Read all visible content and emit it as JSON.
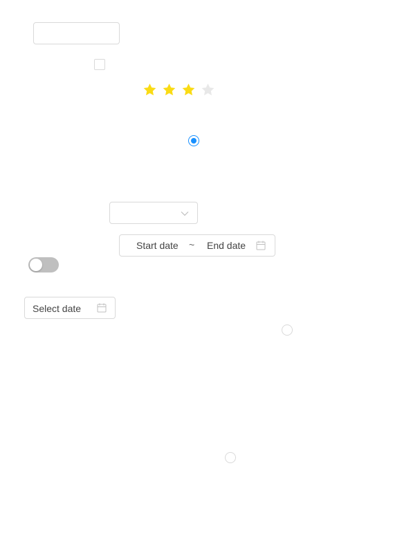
{
  "form": {
    "text_input": {
      "value": "",
      "placeholder": ""
    },
    "checkbox": {
      "checked": false
    },
    "rating": {
      "value": 3,
      "max": 5,
      "filled_color": "#fadb14",
      "empty_color": "#e8e8e8"
    },
    "radio_selected": {
      "checked": true,
      "color": "#1890ff"
    },
    "select": {
      "value": "",
      "icon": "chevron-down-icon"
    },
    "range_picker": {
      "start_placeholder": "Start date",
      "separator": "~",
      "end_placeholder": "End date",
      "icon": "calendar-icon"
    },
    "switch": {
      "on": false
    },
    "date_picker": {
      "placeholder": "Select date",
      "icon": "calendar-icon"
    },
    "radio_a": {
      "checked": false
    },
    "radio_b": {
      "checked": false
    }
  }
}
